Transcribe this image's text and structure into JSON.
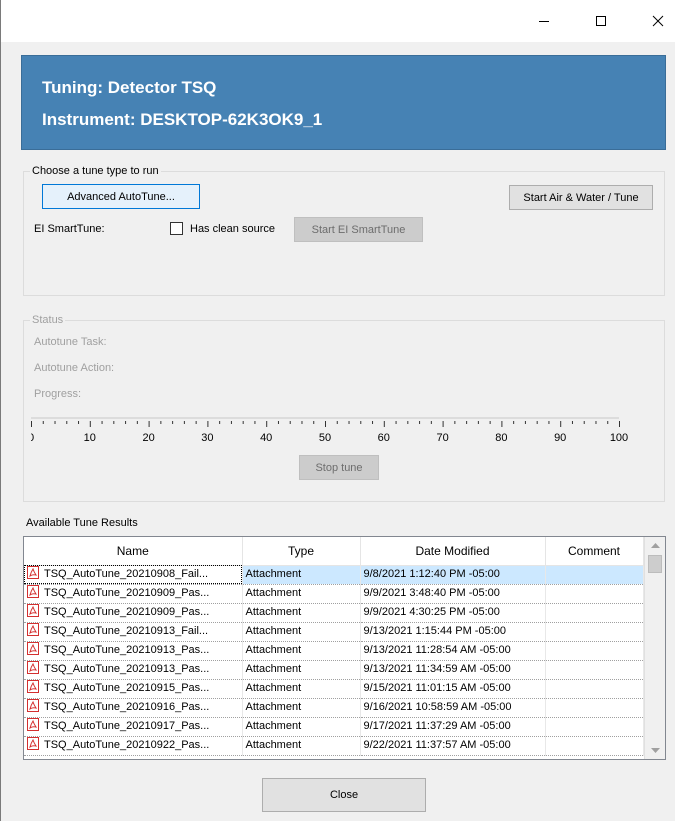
{
  "titlebar": {
    "minimize_icon": "minimize-icon",
    "maximize_icon": "maximize-icon",
    "close_icon": "close-icon"
  },
  "header": {
    "title": "Tuning: Detector TSQ",
    "instrument": "Instrument: DESKTOP-62K3OK9_1",
    "background": "#4682b4"
  },
  "tune_type": {
    "legend": "Choose a tune type to run",
    "advanced_autotune": "Advanced AutoTune...",
    "start_air_water": "Start Air & Water / Tune",
    "ei_smarttune_label": "EI SmartTune:",
    "has_clean_source": "Has clean source",
    "has_clean_source_checked": false,
    "start_ei_smarttune": "Start EI SmartTune"
  },
  "status": {
    "legend": "Status",
    "autotune_task": "Autotune Task:",
    "autotune_action": "Autotune Action:",
    "progress": "Progress:",
    "progress_value": 0,
    "scale_labels": [
      "0",
      "10",
      "20",
      "30",
      "40",
      "50",
      "60",
      "70",
      "80",
      "90",
      "100"
    ],
    "stop_tune": "Stop tune"
  },
  "results": {
    "title": "Available Tune Results",
    "columns": [
      "Name",
      "Type",
      "Date Modified",
      "Comment"
    ],
    "rows": [
      {
        "name": "TSQ_AutoTune_20210908_Fail...",
        "type": "Attachment",
        "date": "9/8/2021 1:12:40 PM -05:00",
        "comment": ""
      },
      {
        "name": "TSQ_AutoTune_20210909_Pas...",
        "type": "Attachment",
        "date": "9/9/2021 3:48:40 PM -05:00",
        "comment": ""
      },
      {
        "name": "TSQ_AutoTune_20210909_Pas...",
        "type": "Attachment",
        "date": "9/9/2021 4:30:25 PM -05:00",
        "comment": ""
      },
      {
        "name": "TSQ_AutoTune_20210913_Fail...",
        "type": "Attachment",
        "date": "9/13/2021 1:15:44 PM -05:00",
        "comment": ""
      },
      {
        "name": "TSQ_AutoTune_20210913_Pas...",
        "type": "Attachment",
        "date": "9/13/2021 11:28:54 AM -05:00",
        "comment": ""
      },
      {
        "name": "TSQ_AutoTune_20210913_Pas...",
        "type": "Attachment",
        "date": "9/13/2021 11:34:59 AM -05:00",
        "comment": ""
      },
      {
        "name": "TSQ_AutoTune_20210915_Pas...",
        "type": "Attachment",
        "date": "9/15/2021 11:01:15 AM -05:00",
        "comment": ""
      },
      {
        "name": "TSQ_AutoTune_20210916_Pas...",
        "type": "Attachment",
        "date": "9/16/2021 10:58:59 AM -05:00",
        "comment": ""
      },
      {
        "name": "TSQ_AutoTune_20210917_Pas...",
        "type": "Attachment",
        "date": "9/17/2021 11:37:29 AM -05:00",
        "comment": ""
      },
      {
        "name": "TSQ_AutoTune_20210922_Pas...",
        "type": "Attachment",
        "date": "9/22/2021 11:37:57 AM -05:00",
        "comment": ""
      }
    ],
    "selected_index": 0
  },
  "footer": {
    "close": "Close"
  }
}
